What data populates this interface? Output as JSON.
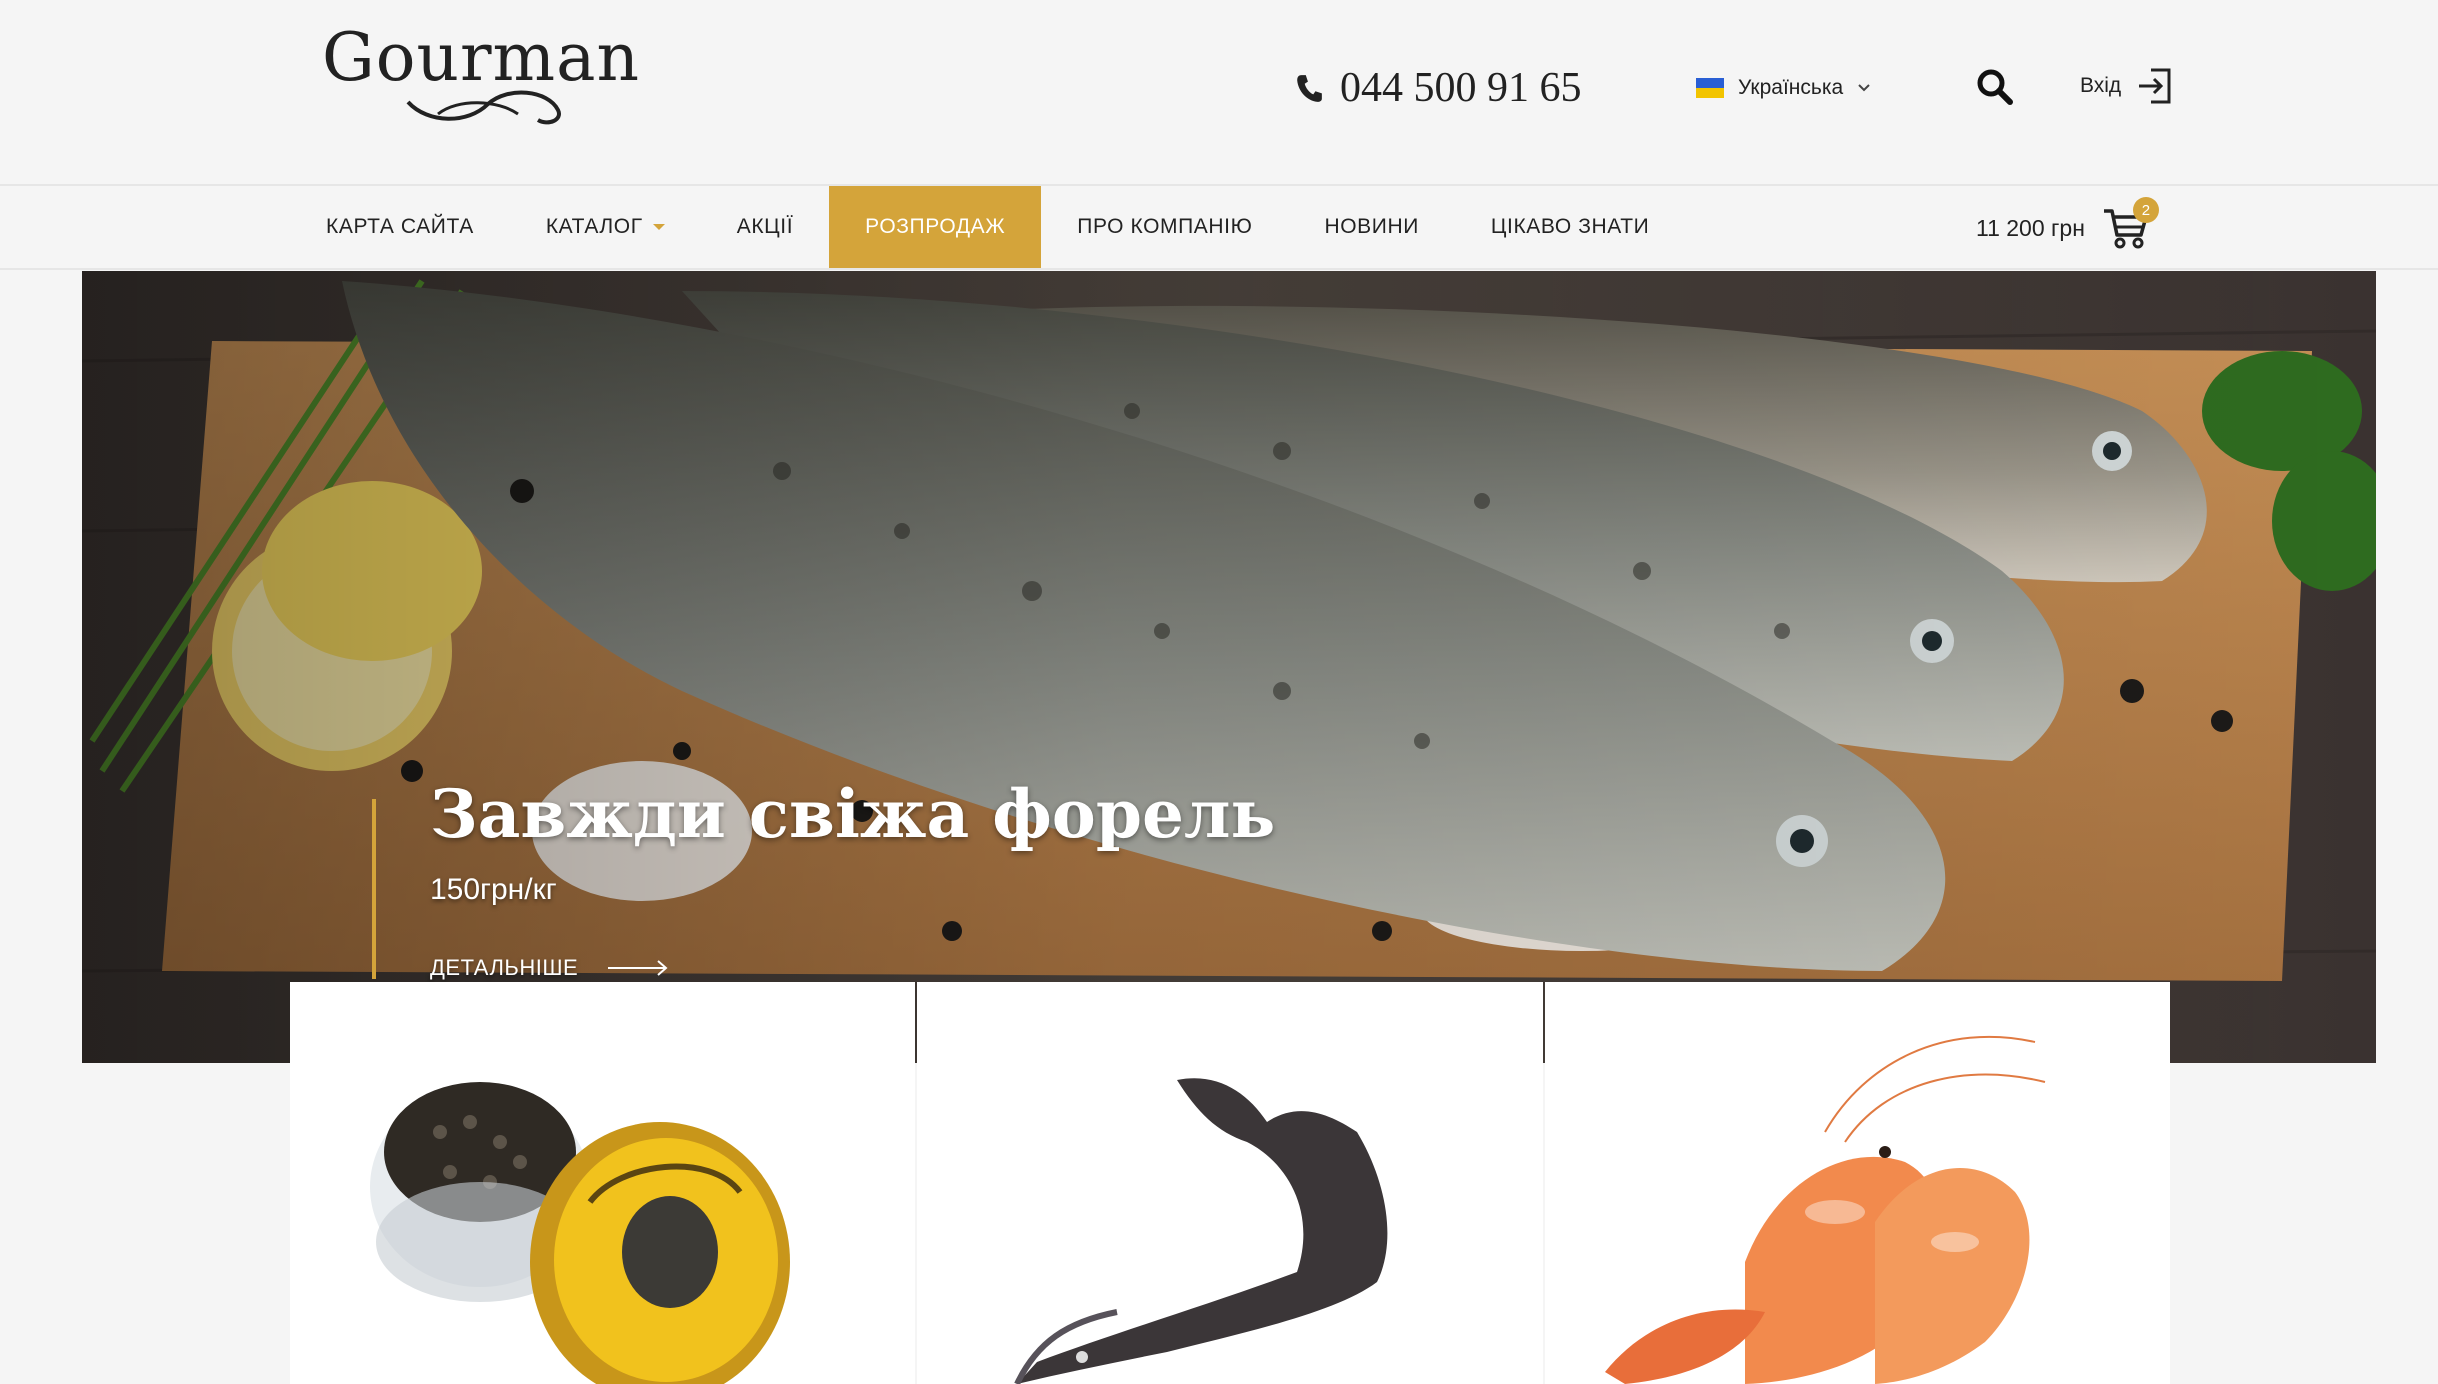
{
  "header": {
    "logo_text": "Gourman",
    "phone": "044 500 91 65",
    "language": "Українська",
    "login_label": "Вхід"
  },
  "nav": {
    "items": [
      {
        "label": "КАРТА САЙТА"
      },
      {
        "label": "КАТАЛОГ"
      },
      {
        "label": "АКЦІЇ"
      },
      {
        "label": "РОЗПРОДАЖ"
      },
      {
        "label": "ПРО КОМПАНІЮ"
      },
      {
        "label": "НОВИНИ"
      },
      {
        "label": "ЦІКАВО ЗНАТИ"
      }
    ],
    "active_index": 3
  },
  "cart": {
    "total": "11 200 грн",
    "count": "2"
  },
  "hero": {
    "title": "Завжди свіжа форель",
    "price": "150грн/кг",
    "more_label": "ДЕТАЛЬНІШЕ"
  },
  "products": [
    {
      "image": "caviar-jar-image"
    },
    {
      "image": "sturgeon-image"
    },
    {
      "image": "shrimp-image"
    }
  ],
  "colors": {
    "accent": "#d4a43a",
    "background": "#f5f5f5",
    "text": "#222222"
  }
}
